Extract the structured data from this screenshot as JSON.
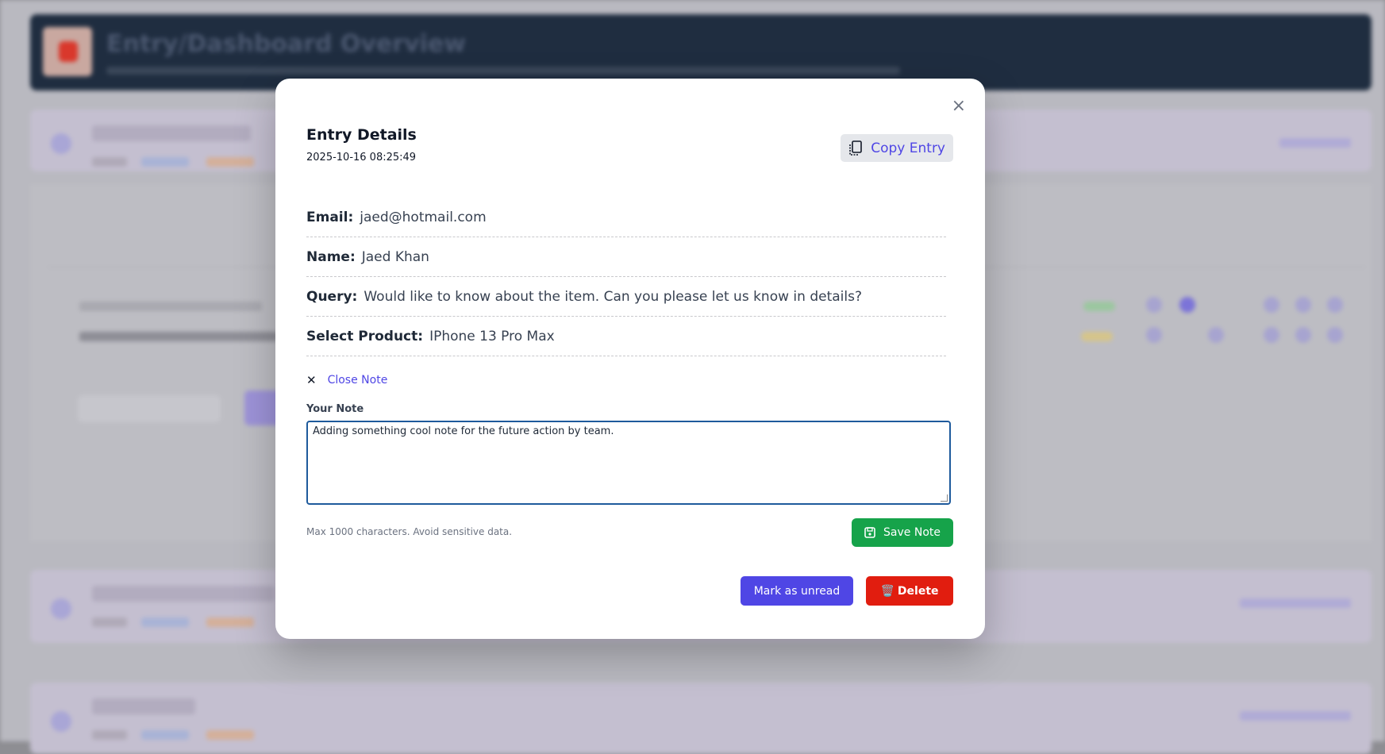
{
  "background": {
    "header_title": "Entry/Dashboard Overview"
  },
  "modal": {
    "title": "Entry Details",
    "timestamp": "2025-10-16 08:25:49",
    "copy_label": "Copy Entry",
    "close_icon": "×",
    "fields": [
      {
        "label": "Email:",
        "value": "jaed@hotmail.com"
      },
      {
        "label": "Name:",
        "value": "Jaed Khan"
      },
      {
        "label": "Query:",
        "value": "Would like to know about the item. Can you please let us know in details?"
      },
      {
        "label": "Select Product:",
        "value": "IPhone 13 Pro Max"
      }
    ],
    "close_note_icon": "✕",
    "close_note_label": "Close Note",
    "note_label": "Your Note",
    "note_value": "Adding something cool note for the future action by team.",
    "note_hint": "Max 1000 characters. Avoid sensitive data.",
    "save_label": "Save Note",
    "mark_unread_label": "Mark as unread",
    "delete_icon": "🗑️",
    "delete_label": "Delete"
  },
  "colors": {
    "primary": "#4f46e5",
    "success": "#16a34a",
    "danger": "#e11d0f"
  }
}
